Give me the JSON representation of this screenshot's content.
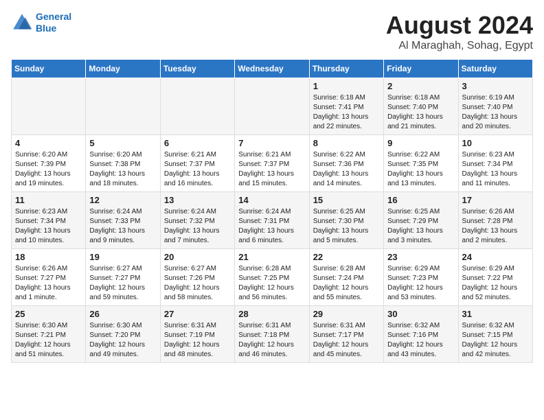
{
  "logo": {
    "line1": "General",
    "line2": "Blue"
  },
  "title": "August 2024",
  "subtitle": "Al Maraghah, Sohag, Egypt",
  "days": [
    "Sunday",
    "Monday",
    "Tuesday",
    "Wednesday",
    "Thursday",
    "Friday",
    "Saturday"
  ],
  "weeks": [
    [
      {
        "num": "",
        "text": ""
      },
      {
        "num": "",
        "text": ""
      },
      {
        "num": "",
        "text": ""
      },
      {
        "num": "",
        "text": ""
      },
      {
        "num": "1",
        "text": "Sunrise: 6:18 AM\nSunset: 7:41 PM\nDaylight: 13 hours and 22 minutes."
      },
      {
        "num": "2",
        "text": "Sunrise: 6:18 AM\nSunset: 7:40 PM\nDaylight: 13 hours and 21 minutes."
      },
      {
        "num": "3",
        "text": "Sunrise: 6:19 AM\nSunset: 7:40 PM\nDaylight: 13 hours and 20 minutes."
      }
    ],
    [
      {
        "num": "4",
        "text": "Sunrise: 6:20 AM\nSunset: 7:39 PM\nDaylight: 13 hours and 19 minutes."
      },
      {
        "num": "5",
        "text": "Sunrise: 6:20 AM\nSunset: 7:38 PM\nDaylight: 13 hours and 18 minutes."
      },
      {
        "num": "6",
        "text": "Sunrise: 6:21 AM\nSunset: 7:37 PM\nDaylight: 13 hours and 16 minutes."
      },
      {
        "num": "7",
        "text": "Sunrise: 6:21 AM\nSunset: 7:37 PM\nDaylight: 13 hours and 15 minutes."
      },
      {
        "num": "8",
        "text": "Sunrise: 6:22 AM\nSunset: 7:36 PM\nDaylight: 13 hours and 14 minutes."
      },
      {
        "num": "9",
        "text": "Sunrise: 6:22 AM\nSunset: 7:35 PM\nDaylight: 13 hours and 13 minutes."
      },
      {
        "num": "10",
        "text": "Sunrise: 6:23 AM\nSunset: 7:34 PM\nDaylight: 13 hours and 11 minutes."
      }
    ],
    [
      {
        "num": "11",
        "text": "Sunrise: 6:23 AM\nSunset: 7:34 PM\nDaylight: 13 hours and 10 minutes."
      },
      {
        "num": "12",
        "text": "Sunrise: 6:24 AM\nSunset: 7:33 PM\nDaylight: 13 hours and 9 minutes."
      },
      {
        "num": "13",
        "text": "Sunrise: 6:24 AM\nSunset: 7:32 PM\nDaylight: 13 hours and 7 minutes."
      },
      {
        "num": "14",
        "text": "Sunrise: 6:24 AM\nSunset: 7:31 PM\nDaylight: 13 hours and 6 minutes."
      },
      {
        "num": "15",
        "text": "Sunrise: 6:25 AM\nSunset: 7:30 PM\nDaylight: 13 hours and 5 minutes."
      },
      {
        "num": "16",
        "text": "Sunrise: 6:25 AM\nSunset: 7:29 PM\nDaylight: 13 hours and 3 minutes."
      },
      {
        "num": "17",
        "text": "Sunrise: 6:26 AM\nSunset: 7:28 PM\nDaylight: 13 hours and 2 minutes."
      }
    ],
    [
      {
        "num": "18",
        "text": "Sunrise: 6:26 AM\nSunset: 7:27 PM\nDaylight: 13 hours and 1 minute."
      },
      {
        "num": "19",
        "text": "Sunrise: 6:27 AM\nSunset: 7:27 PM\nDaylight: 12 hours and 59 minutes."
      },
      {
        "num": "20",
        "text": "Sunrise: 6:27 AM\nSunset: 7:26 PM\nDaylight: 12 hours and 58 minutes."
      },
      {
        "num": "21",
        "text": "Sunrise: 6:28 AM\nSunset: 7:25 PM\nDaylight: 12 hours and 56 minutes."
      },
      {
        "num": "22",
        "text": "Sunrise: 6:28 AM\nSunset: 7:24 PM\nDaylight: 12 hours and 55 minutes."
      },
      {
        "num": "23",
        "text": "Sunrise: 6:29 AM\nSunset: 7:23 PM\nDaylight: 12 hours and 53 minutes."
      },
      {
        "num": "24",
        "text": "Sunrise: 6:29 AM\nSunset: 7:22 PM\nDaylight: 12 hours and 52 minutes."
      }
    ],
    [
      {
        "num": "25",
        "text": "Sunrise: 6:30 AM\nSunset: 7:21 PM\nDaylight: 12 hours and 51 minutes."
      },
      {
        "num": "26",
        "text": "Sunrise: 6:30 AM\nSunset: 7:20 PM\nDaylight: 12 hours and 49 minutes."
      },
      {
        "num": "27",
        "text": "Sunrise: 6:31 AM\nSunset: 7:19 PM\nDaylight: 12 hours and 48 minutes."
      },
      {
        "num": "28",
        "text": "Sunrise: 6:31 AM\nSunset: 7:18 PM\nDaylight: 12 hours and 46 minutes."
      },
      {
        "num": "29",
        "text": "Sunrise: 6:31 AM\nSunset: 7:17 PM\nDaylight: 12 hours and 45 minutes."
      },
      {
        "num": "30",
        "text": "Sunrise: 6:32 AM\nSunset: 7:16 PM\nDaylight: 12 hours and 43 minutes."
      },
      {
        "num": "31",
        "text": "Sunrise: 6:32 AM\nSunset: 7:15 PM\nDaylight: 12 hours and 42 minutes."
      }
    ]
  ]
}
